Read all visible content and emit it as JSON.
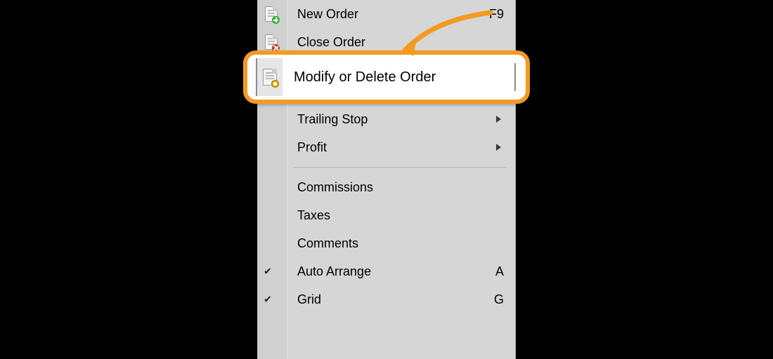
{
  "accent_color": "#f39a1f",
  "menu": {
    "items": [
      {
        "label": "New Order",
        "shortcut": "F9",
        "icon": "doc-plus",
        "checked": false,
        "submenu": false
      },
      {
        "label": "Close Order",
        "shortcut": "",
        "icon": "doc-x",
        "checked": false,
        "submenu": false
      }
    ],
    "highlighted": {
      "label": "Modify or Delete Order",
      "icon": "doc-gear"
    },
    "post_sep_items": [
      {
        "label": "Trailing Stop",
        "shortcut": "",
        "icon": "",
        "checked": false,
        "submenu": true
      },
      {
        "label": "Profit",
        "shortcut": "",
        "icon": "",
        "checked": false,
        "submenu": true
      }
    ],
    "items2": [
      {
        "label": "Commissions",
        "shortcut": "",
        "icon": "",
        "checked": false,
        "submenu": false
      },
      {
        "label": "Taxes",
        "shortcut": "",
        "icon": "",
        "checked": false,
        "submenu": false
      },
      {
        "label": "Comments",
        "shortcut": "",
        "icon": "",
        "checked": false,
        "submenu": false
      },
      {
        "label": "Auto Arrange",
        "shortcut": "A",
        "icon": "",
        "checked": true,
        "submenu": false
      },
      {
        "label": "Grid",
        "shortcut": "G",
        "icon": "",
        "checked": true,
        "submenu": false
      }
    ]
  }
}
